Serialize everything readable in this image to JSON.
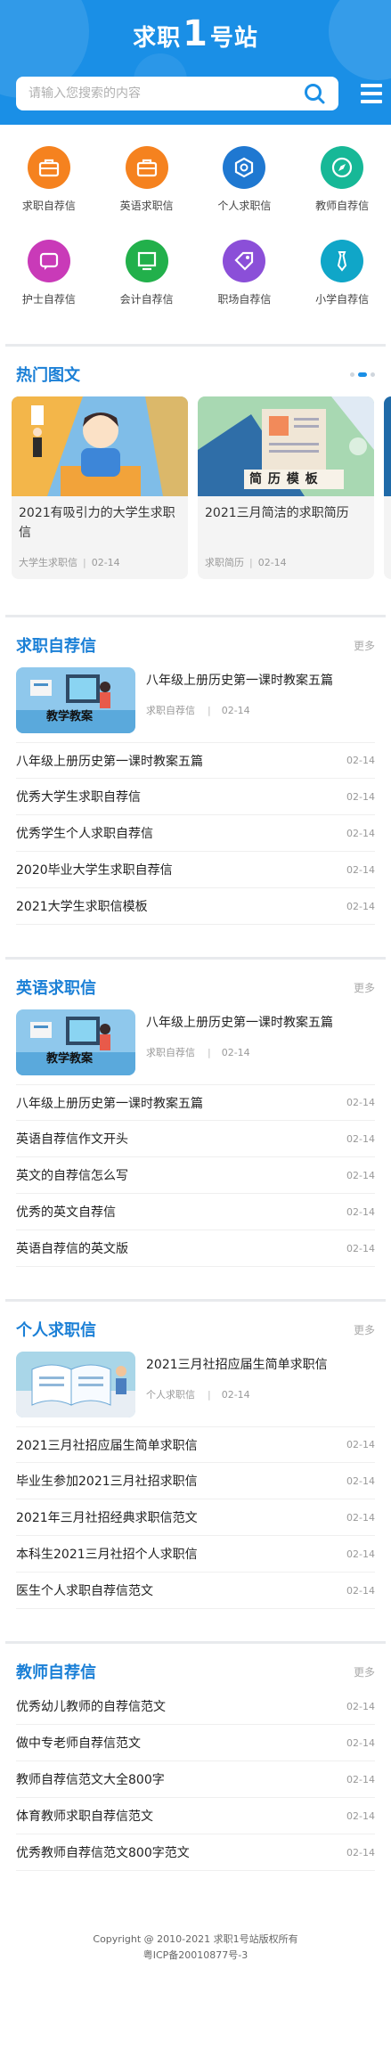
{
  "header": {
    "logo_pre": "求职",
    "logo_num": "1",
    "logo_post": "号站",
    "search_placeholder": "请输入您搜索的内容",
    "bg_color": "#1a8fe6"
  },
  "categories": [
    {
      "label": "求职自荐信",
      "icon": "briefcase-icon",
      "color": "#f5821f"
    },
    {
      "label": "英语求职信",
      "icon": "briefcase-icon",
      "color": "#f5821f"
    },
    {
      "label": "个人求职信",
      "icon": "hexagon-icon",
      "color": "#1f78d1"
    },
    {
      "label": "教师自荐信",
      "icon": "compass-icon",
      "color": "#17b897"
    },
    {
      "label": "护士自荐信",
      "icon": "chat-icon",
      "color": "#c93ab8"
    },
    {
      "label": "会计自荐信",
      "icon": "monitor-icon",
      "color": "#22b04b"
    },
    {
      "label": "职场自荐信",
      "icon": "tag-icon",
      "color": "#8b4fd8"
    },
    {
      "label": "小学自荐信",
      "icon": "tie-icon",
      "color": "#10a6c8"
    }
  ],
  "hot": {
    "title": "热门图文",
    "cards": [
      {
        "title": "2021有吸引力的大学生求职信",
        "category": "大学生求职信",
        "date": "02-14"
      },
      {
        "title": "2021三月简洁的求职简历",
        "category": "求职简历",
        "date": "02-14",
        "banner": "简 历 模 板"
      }
    ]
  },
  "sections": [
    {
      "title": "求职自荐信",
      "more": "更多",
      "feature": {
        "title": "八年级上册历史第一课时教案五篇",
        "category": "求职自荐信",
        "date": "02-14",
        "banner": "教学教案"
      },
      "items": [
        {
          "title": "八年级上册历史第一课时教案五篇",
          "date": "02-14"
        },
        {
          "title": "优秀大学生求职自荐信",
          "date": "02-14"
        },
        {
          "title": "优秀学生个人求职自荐信",
          "date": "02-14"
        },
        {
          "title": "2020毕业大学生求职自荐信",
          "date": "02-14"
        },
        {
          "title": "2021大学生求职信模板",
          "date": "02-14"
        }
      ]
    },
    {
      "title": "英语求职信",
      "more": "更多",
      "feature": {
        "title": "八年级上册历史第一课时教案五篇",
        "category": "求职自荐信",
        "date": "02-14",
        "banner": "教学教案"
      },
      "items": [
        {
          "title": "八年级上册历史第一课时教案五篇",
          "date": "02-14"
        },
        {
          "title": "英语自荐信作文开头",
          "date": "02-14"
        },
        {
          "title": "英文的自荐信怎么写",
          "date": "02-14"
        },
        {
          "title": "优秀的英文自荐信",
          "date": "02-14"
        },
        {
          "title": "英语自荐信的英文版",
          "date": "02-14"
        }
      ]
    },
    {
      "title": "个人求职信",
      "more": "更多",
      "feature": {
        "title": "2021三月社招应届生简单求职信",
        "category": "个人求职信",
        "date": "02-14"
      },
      "items": [
        {
          "title": "2021三月社招应届生简单求职信",
          "date": "02-14"
        },
        {
          "title": "毕业生参加2021三月社招求职信",
          "date": "02-14"
        },
        {
          "title": "2021年三月社招经典求职信范文",
          "date": "02-14"
        },
        {
          "title": "本科生2021三月社招个人求职信",
          "date": "02-14"
        },
        {
          "title": "医生个人求职自荐信范文",
          "date": "02-14"
        }
      ]
    },
    {
      "title": "教师自荐信",
      "more": "更多",
      "items": [
        {
          "title": "优秀幼儿教师的自荐信范文",
          "date": "02-14"
        },
        {
          "title": "做中专老师自荐信范文",
          "date": "02-14"
        },
        {
          "title": "教师自荐信范文大全800字",
          "date": "02-14"
        },
        {
          "title": "体育教师求职自荐信范文",
          "date": "02-14"
        },
        {
          "title": "优秀教师自荐信范文800字范文",
          "date": "02-14"
        }
      ]
    }
  ],
  "footer": {
    "copyright": "Copyright @ 2010-2021 求职1号站版权所有",
    "icp": "粤ICP备20010877号-3"
  }
}
